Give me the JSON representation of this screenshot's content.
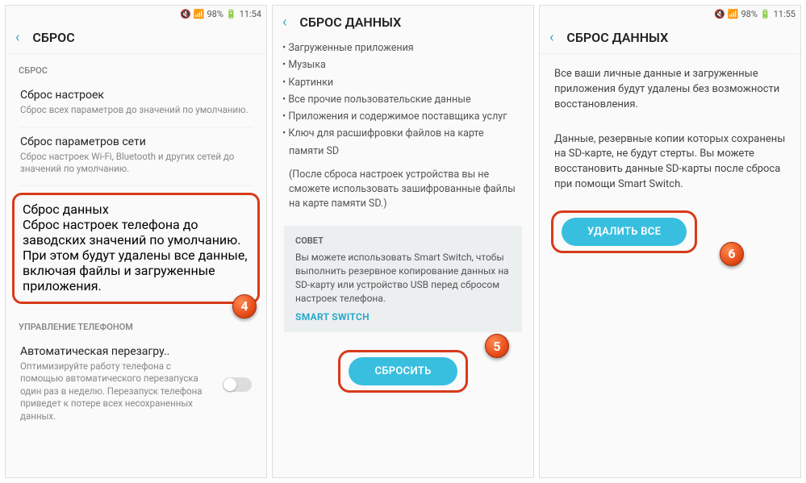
{
  "status": {
    "mute": "🔇",
    "signal": "📶",
    "batt": "98%",
    "icon": "🔋"
  },
  "time": {
    "a": "11:54",
    "b": "11:55"
  },
  "screen1": {
    "title": "СБРОС",
    "sec1": "СБРОС",
    "item1_t": "Сброс настроек",
    "item1_d": "Сброс всех параметров до значений по умолчанию.",
    "item2_t": "Сброс параметров сети",
    "item2_d": "Сброс настроек Wi-Fi, Bluetooth и других сетей до значений по умолчанию.",
    "item3_t": "Сброс данных",
    "item3_d": "Сброс настроек телефона до заводских значений по умолчанию. При этом будут удалены все данные, включая файлы и загруженные приложения.",
    "sec2": "УПРАВЛЕНИЕ ТЕЛЕФОНОМ",
    "item4_t": "Автоматическая перезагру..",
    "item4_d": "Оптимизируйте работу телефона с помощью автоматического перезапуска один раз в неделю. Перезапуск телефона приведет к потере всех несохраненных данных.",
    "badge": "4"
  },
  "screen2": {
    "title": "СБРОС ДАННЫХ",
    "bullets": [
      "Загруженные приложения",
      "Музыка",
      "Картинки",
      "Все прочие пользовательские данные",
      "Приложения и содержимое поставщика услуг",
      "Ключ для расшифровки файлов на карте памяти SD"
    ],
    "note": "(После сброса настроек устройства вы не сможете использовать зашифрованные файлы на карте памяти SD.)",
    "tip_label": "СОВЕТ",
    "tip_text": "Вы можете использовать Smart Switch, чтобы выполнить резервное копирование данных на SD-карту или устройство USB перед сбросом настроек телефона.",
    "tip_link": "SMART SWITCH",
    "button": "СБРОСИТЬ",
    "badge": "5"
  },
  "screen3": {
    "title": "СБРОС ДАННЫХ",
    "p1": "Все ваши личные данные и загруженные приложения будут удалены без возможности восстановления.",
    "p2": "Данные, резервные копии которых сохранены на SD-карте, не будут стерты. Вы можете восстановить данные SD-карты после сброса при помощи Smart Switch.",
    "button": "УДАЛИТЬ ВСЕ",
    "badge": "6"
  }
}
